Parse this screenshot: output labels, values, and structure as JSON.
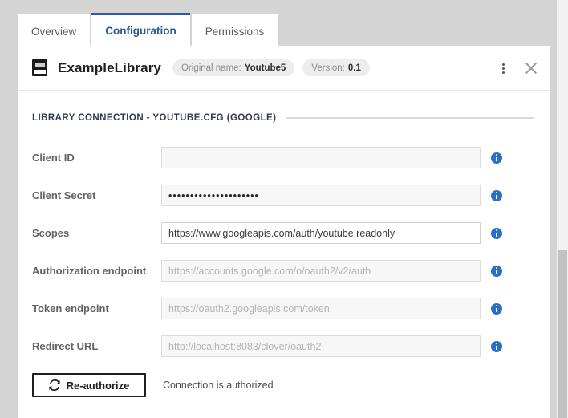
{
  "tabs": [
    {
      "label": "Overview",
      "active": false
    },
    {
      "label": "Configuration",
      "active": true
    },
    {
      "label": "Permissions",
      "active": false
    }
  ],
  "header": {
    "icon": "book-icon",
    "title": "ExampleLibrary",
    "badges": [
      {
        "label": "Original name:",
        "value": "Youtube5"
      },
      {
        "label": "Version:",
        "value": "0.1"
      }
    ],
    "menu_icon": "kebab-menu-icon",
    "close_icon": "close-icon"
  },
  "section": {
    "title": "LIBRARY CONNECTION - YOUTUBE.CFG (GOOGLE)"
  },
  "fields": [
    {
      "label": "Client ID",
      "value": "",
      "placeholder": "",
      "style": "empty"
    },
    {
      "label": "Client Secret",
      "value": "•••••••••••••••••••••",
      "placeholder": "",
      "style": "secret"
    },
    {
      "label": "Scopes",
      "value": "https://www.googleapis.com/auth/youtube.readonly",
      "placeholder": "",
      "style": "filled-white"
    },
    {
      "label": "Authorization endpoint",
      "value": "",
      "placeholder": "https://accounts.google.com/o/oauth2/v2/auth",
      "style": "empty"
    },
    {
      "label": "Token endpoint",
      "value": "",
      "placeholder": "https://oauth2.googleapis.com/token",
      "style": "empty"
    },
    {
      "label": "Redirect URL",
      "value": "",
      "placeholder": "http://localhost:8083/clover/oauth2",
      "style": "empty"
    }
  ],
  "auth": {
    "button_label": "Re-authorize",
    "button_icon": "refresh-icon",
    "status_text": "Connection is authorized"
  },
  "colors": {
    "accent": "#2b5797",
    "tab_active_border": "#2e5c9a",
    "info_icon": "#2a6fc4",
    "section_title": "#2f3d52",
    "page_background": "#d4d4d4",
    "panel_background": "#ffffff",
    "scrollbar_thumb": "#c1c1c1"
  }
}
